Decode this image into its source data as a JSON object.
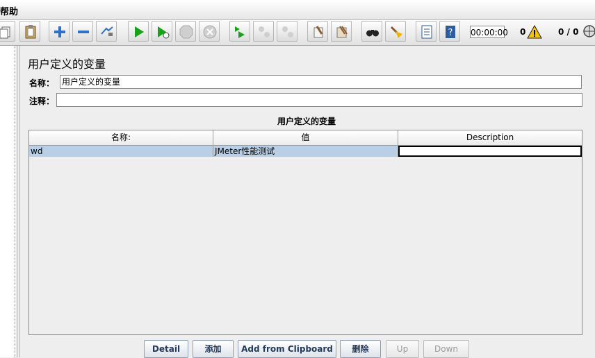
{
  "menubar": {
    "visible_menu": "帮助"
  },
  "toolbar": {
    "timer": "00:00:00",
    "error_count": "0",
    "thread_count": "0 / 0",
    "icons": [
      "copy-icon",
      "paste-icon",
      "expand-icon",
      "collapse-icon",
      "toggle-icon",
      "start-icon",
      "start-no-pause-icon",
      "stop-icon",
      "shutdown-icon",
      "remote-start-icon",
      "remote-stop-icon",
      "remote-shutdown-icon",
      "clear-icon",
      "clear-all-icon",
      "search-icon",
      "reset-search-icon",
      "function-helper-icon",
      "help-icon",
      "warning-icon",
      "globe-icon"
    ]
  },
  "panel": {
    "title": "用户定义的变量",
    "name_label": "名称：",
    "name_value": "用户定义的变量",
    "comment_label": "注释：",
    "comment_value": ""
  },
  "table": {
    "caption": "用户定义的变量",
    "columns": [
      "名称:",
      "值",
      "Description"
    ],
    "rows": [
      {
        "name": "wd",
        "value": "JMeter性能测试",
        "description": ""
      }
    ]
  },
  "buttons": {
    "detail": "Detail",
    "add": "添加",
    "clipboard": "Add from Clipboard",
    "delete": "删除",
    "up": "Up",
    "down": "Down"
  },
  "colors": {
    "selected_row": "#b8cfe5",
    "start_green": "#1aa11a",
    "add_blue": "#2f6fc8"
  }
}
